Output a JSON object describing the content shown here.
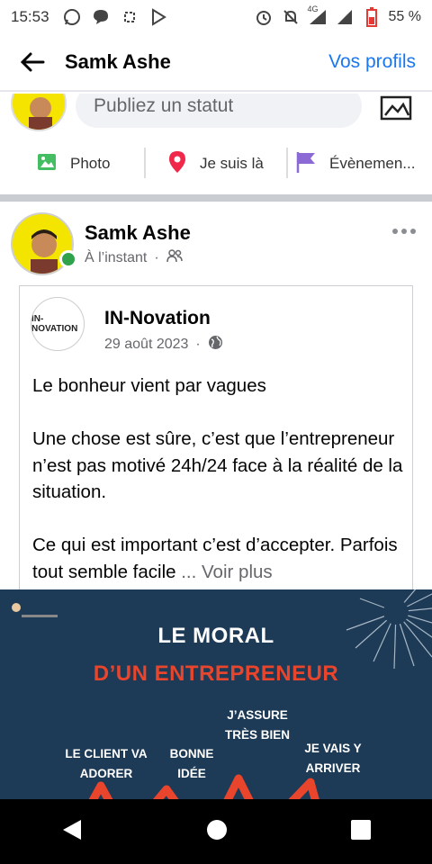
{
  "status_bar": {
    "time": "15:53",
    "network": "4G",
    "battery_pct": "55 %"
  },
  "header": {
    "title": "Samk Ashe",
    "profiles_link": "Vos profils"
  },
  "composer": {
    "placeholder": "Publiez un statut",
    "actions": [
      {
        "label": "Photo",
        "icon": "photo-icon"
      },
      {
        "label": "Je suis là",
        "icon": "location-pin-icon"
      },
      {
        "label": "Évènemen...",
        "icon": "event-flag-icon"
      }
    ]
  },
  "post": {
    "author": "Samk Ashe",
    "time": "À l’instant",
    "audience_icon": "friends-icon",
    "shared": {
      "page_name": "IN-Novation",
      "logo_text": "IN-NOVATION",
      "date": "29 août 2023",
      "audience_icon": "globe-icon",
      "paragraphs": [
        "Le bonheur vient par vagues",
        "Une chose est sûre, c’est que l’entrepreneur n’est pas motivé 24h/24 face à la réalité de la situation."
      ],
      "last_text": "Ce qui est important c’est d’accepter. Parfois tout semble facile ",
      "see_more": "... Voir plus"
    },
    "image": {
      "title_line1": "LE MORAL",
      "title_line2": "D’UN ENTREPRENEUR",
      "labels": [
        "LE CLIENT VA ADORER",
        "BONNE IDÉE",
        "J’ASSURE TRÈS BIEN",
        "JE VAIS Y ARRIVER"
      ],
      "bg_color": "#1d3a56",
      "accent_color": "#e8452c"
    }
  },
  "colors": {
    "brand_blue": "#1877f2",
    "online_green": "#31a24c"
  }
}
